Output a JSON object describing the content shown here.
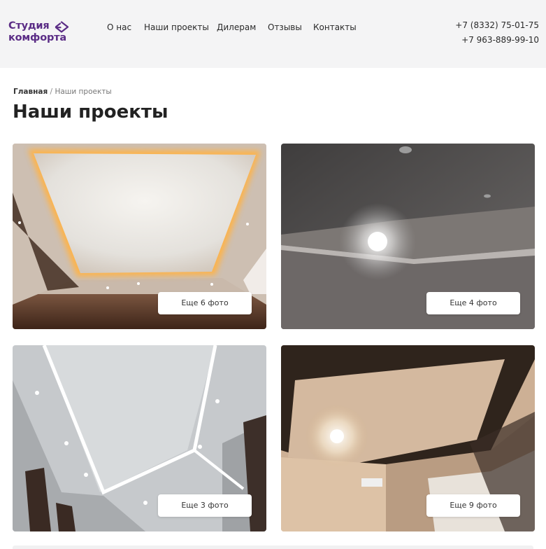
{
  "brand": {
    "line1": "Студия",
    "line2": "комфорта",
    "color": "#5b2d86",
    "icon": "diamond-arrow-icon"
  },
  "nav": [
    {
      "label": "О нас"
    },
    {
      "label": "Наши проекты"
    },
    {
      "label": "Дилерам"
    },
    {
      "label": "Отзывы"
    },
    {
      "label": "Контакты"
    }
  ],
  "phones": [
    "+7 (8332) 75-01-75",
    "+7 963-889-99-10"
  ],
  "breadcrumb": {
    "home": "Главная",
    "separator": "/",
    "current": "Наши проекты"
  },
  "page_title": "Наши проекты",
  "projects": [
    {
      "more_label": "Еще 6 фото"
    },
    {
      "more_label": "Еще 4 фото"
    },
    {
      "more_label": "Еще 3 фото"
    },
    {
      "more_label": "Еще 9 фото"
    }
  ]
}
